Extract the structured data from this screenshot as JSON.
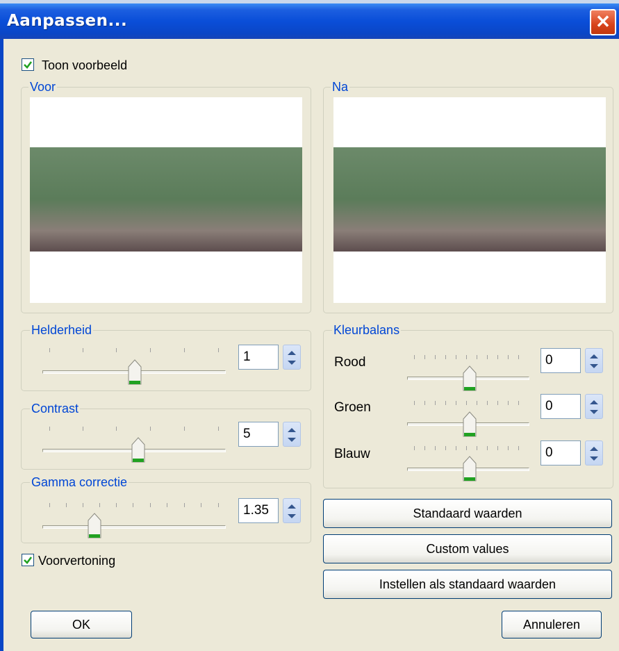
{
  "window": {
    "title": "Aanpassen...",
    "close_glyph": "✕"
  },
  "toon_voorbeeld": {
    "label": "Toon voorbeeld",
    "checked": true
  },
  "preview": {
    "before_title": "Voor",
    "after_title": "Na"
  },
  "helderheid": {
    "title": "Helderheid",
    "value": "1"
  },
  "contrast": {
    "title": "Contrast",
    "value": "5"
  },
  "gamma": {
    "title": "Gamma correctie",
    "value": "1.35"
  },
  "voorvertoning": {
    "label": "Voorvertoning",
    "checked": true
  },
  "kleurbalans": {
    "title": "Kleurbalans",
    "rood": {
      "label": "Rood",
      "value": "0"
    },
    "groen": {
      "label": "Groen",
      "value": "0"
    },
    "blauw": {
      "label": "Blauw",
      "value": "0"
    }
  },
  "buttons": {
    "standaard": "Standaard waarden",
    "custom": "Custom values",
    "instellen": "Instellen als standaard waarden",
    "ok": "OK",
    "annuleren": "Annuleren"
  },
  "colors": {
    "title_bar": "#0a46c6",
    "group_title": "#0046d5",
    "dialog_bg": "#ece9d8",
    "thumb_green": "#21a121"
  },
  "icons": {
    "close": "close-icon",
    "check": "check-icon",
    "spin": "spin-arrows-icon"
  }
}
